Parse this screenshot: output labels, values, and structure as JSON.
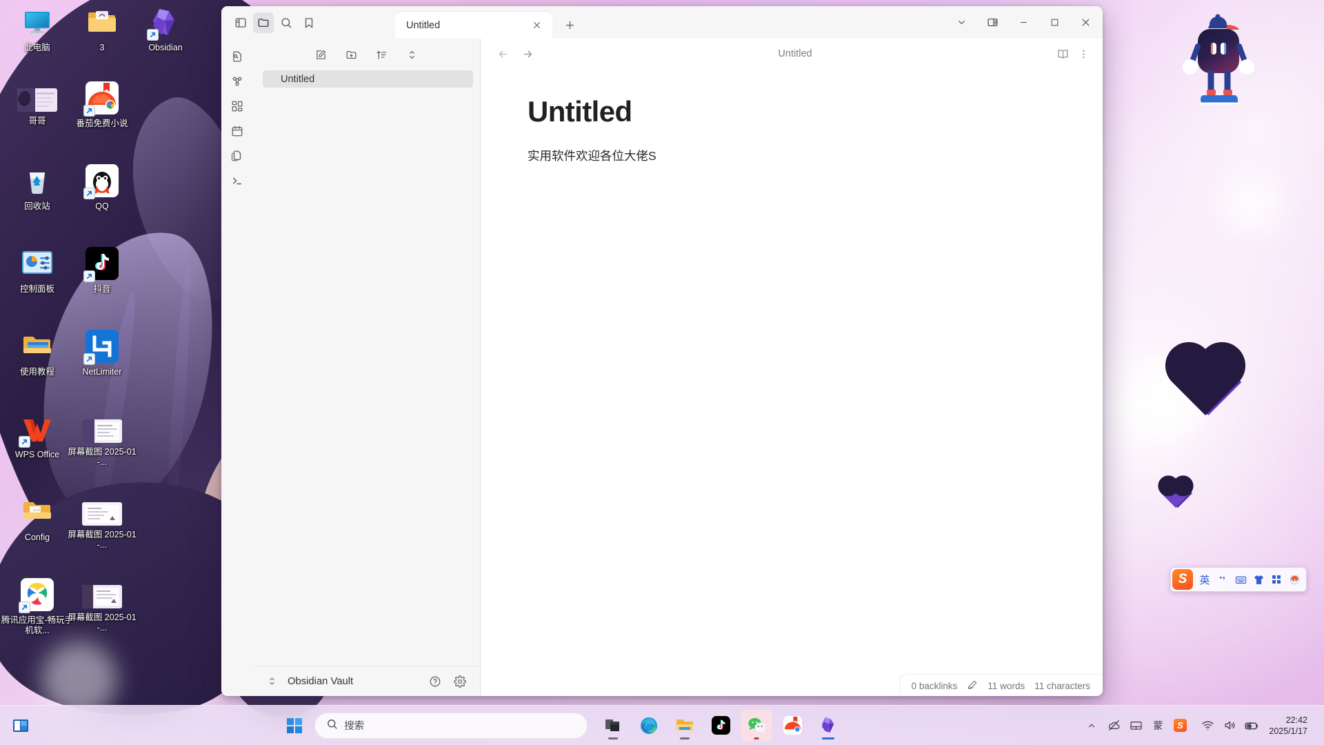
{
  "desktop": {
    "icons": [
      {
        "label": "此电脑",
        "icon": "this-pc-icon",
        "shortcut": false
      },
      {
        "label": "3",
        "icon": "folder-icon",
        "shortcut": false
      },
      {
        "label": "哥哥",
        "icon": "image-thumbnail-icon",
        "shortcut": false
      },
      {
        "label": "番茄免费小说",
        "icon": "tomato-novel-icon",
        "shortcut": true
      },
      {
        "label": "回收站",
        "icon": "recycle-bin-icon",
        "shortcut": false
      },
      {
        "label": "QQ",
        "icon": "qq-penguin-icon",
        "shortcut": true
      },
      {
        "label": "控制面板",
        "icon": "control-panel-icon",
        "shortcut": false
      },
      {
        "label": "抖音",
        "icon": "douyin-icon",
        "shortcut": true
      },
      {
        "label": "使用教程",
        "icon": "folder-icon",
        "shortcut": false
      },
      {
        "label": "NetLimiter",
        "icon": "netlimiter-icon",
        "shortcut": true
      },
      {
        "label": "WPS Office",
        "icon": "wps-office-icon",
        "shortcut": true
      },
      {
        "label": "屏幕截图 2025-01-...",
        "icon": "screenshot-thumbnail-icon",
        "shortcut": false
      },
      {
        "label": "Config",
        "icon": "folder-icon",
        "shortcut": false
      },
      {
        "label": "屏幕截图 2025-01-...",
        "icon": "screenshot-thumbnail-icon",
        "shortcut": false
      },
      {
        "label": "腾讯应用宝-畅玩手机软...",
        "icon": "tencent-appstore-icon",
        "shortcut": true
      },
      {
        "label": "屏幕截图 2025-01-...",
        "icon": "screenshot-thumbnail-icon",
        "shortcut": false
      },
      {
        "label": "Obsidian",
        "icon": "obsidian-icon",
        "shortcut": true
      }
    ],
    "mascot": "robot-mascot-widget"
  },
  "obsidian": {
    "titlebar": {
      "left_icons": [
        "sidebar-toggle-icon",
        "folder-icon",
        "search-icon",
        "bookmark-icon"
      ],
      "tab": {
        "title": "Untitled",
        "close": "✕"
      },
      "new_tab": "+",
      "window_controls": [
        "chevron-down-icon",
        "right-sidebar-toggle-icon",
        "minimize-icon",
        "maximize-icon",
        "close-icon"
      ]
    },
    "ribbon": {
      "items": [
        "quick-switcher-icon",
        "graph-view-icon",
        "canvas-icon",
        "daily-note-icon",
        "templates-icon",
        "terminal-icon"
      ]
    },
    "file_pane": {
      "toolbar": [
        "new-note-icon",
        "new-folder-icon",
        "sort-icon",
        "collapse-icon"
      ],
      "items": [
        {
          "name": "Untitled",
          "selected": true
        }
      ],
      "footer": {
        "vault_name": "Obsidian Vault",
        "expand_icon": "vault-switcher-icon",
        "help_icon": "help-icon",
        "settings_icon": "settings-gear-icon"
      }
    },
    "editor": {
      "back_icon": "arrow-left-icon",
      "forward_icon": "arrow-right-icon",
      "breadcrumb": "Untitled",
      "reading_view_icon": "open-book-icon",
      "more_options_icon": "more-vertical-icon",
      "doc_title": "Untitled",
      "doc_body": "实用软件欢迎各位大佬S"
    },
    "status_bar": {
      "backlinks": "0 backlinks",
      "edit_icon": "pencil-icon",
      "words": "11 words",
      "characters": "11 characters"
    }
  },
  "taskbar": {
    "corner_icon": "show-desktop-icon",
    "start": "start-windows-icon",
    "search_placeholder": "搜索",
    "search_icon": "search-icon",
    "apps": [
      {
        "name": "task-view-icon",
        "active": false,
        "running": true
      },
      {
        "name": "microsoft-edge-icon",
        "active": false,
        "running": false
      },
      {
        "name": "file-explorer-icon",
        "active": false,
        "running": false
      },
      {
        "name": "douyin-icon",
        "active": false,
        "running": false
      },
      {
        "name": "wechat-icon",
        "active": true,
        "running": true
      },
      {
        "name": "tomato-novel-icon",
        "active": false,
        "running": false
      },
      {
        "name": "obsidian-icon",
        "active": true,
        "running": true
      }
    ],
    "tray": [
      {
        "name": "show-hidden-icons-chevron"
      },
      {
        "name": "onedrive-offline-icon"
      },
      {
        "name": "touchpad-icon"
      },
      {
        "name": "ime-mode-icon",
        "label": "蒙"
      },
      {
        "name": "sogou-input-icon",
        "label": "S"
      },
      {
        "name": "wifi-icon"
      },
      {
        "name": "volume-icon"
      },
      {
        "name": "battery-charging-icon"
      }
    ],
    "clock": {
      "time": "22:42",
      "date": "2025/1/17"
    }
  },
  "ime_bar": {
    "logo": "sogou-logo-icon",
    "buttons": [
      {
        "name": "language-mode-button",
        "label": "英"
      },
      {
        "name": "punctuation-mode-button",
        "label": "，"
      },
      {
        "name": "soft-keyboard-button",
        "label": "keyboard-icon"
      },
      {
        "name": "skin-button",
        "label": "shirt-icon"
      },
      {
        "name": "toolbox-button",
        "label": "grid-icon"
      },
      {
        "name": "emoji-button",
        "label": "emoji-icon"
      }
    ]
  }
}
